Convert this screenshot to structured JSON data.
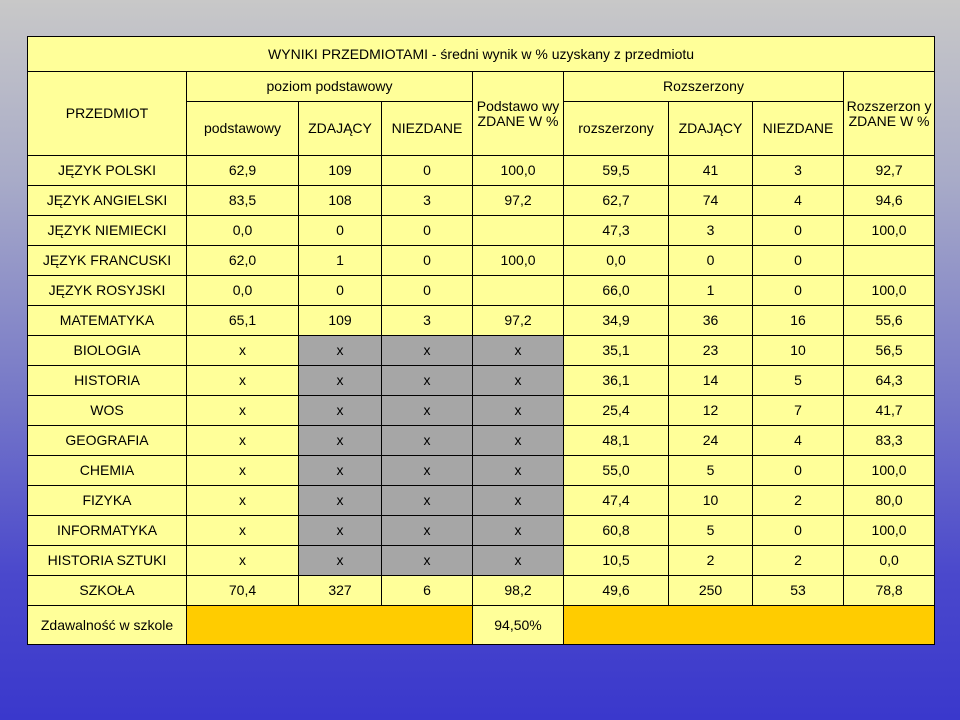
{
  "title": "WYNIKI PRZEDMIOTAMI - średni wynik w % uzyskany z przedmiotu",
  "headers": {
    "przedmiot": "PRZEDMIOT",
    "poziom_podstawowy": "poziom podstawowy",
    "podstawowy_zdane_pct": "Podstawo wy ZDANE W %",
    "rozszerzony_group": "Rozszerzony",
    "rozszerzony_zdane_pct": "Rozszerzon y ZDANE W %",
    "sub": [
      "podstawowy",
      "ZDAJĄCY",
      "NIEZDANE",
      "rozszerzony",
      "ZDAJĄCY",
      "NIEZDANE"
    ]
  },
  "rows": [
    {
      "subject": "JĘZYK POLSKI",
      "p_avg": "62,9",
      "p_taking": "109",
      "p_failed": "0",
      "p_pct": "100,0",
      "r_avg": "59,5",
      "r_taking": "41",
      "r_failed": "3",
      "r_pct": "92,7"
    },
    {
      "subject": "JĘZYK ANGIELSKI",
      "p_avg": "83,5",
      "p_taking": "108",
      "p_failed": "3",
      "p_pct": "97,2",
      "r_avg": "62,7",
      "r_taking": "74",
      "r_failed": "4",
      "r_pct": "94,6"
    },
    {
      "subject": "JĘZYK NIEMIECKI",
      "p_avg": "0,0",
      "p_taking": "0",
      "p_failed": "0",
      "p_pct": "",
      "r_avg": "47,3",
      "r_taking": "3",
      "r_failed": "0",
      "r_pct": "100,0"
    },
    {
      "subject": "JĘZYK FRANCUSKI",
      "p_avg": "62,0",
      "p_taking": "1",
      "p_failed": "0",
      "p_pct": "100,0",
      "r_avg": "0,0",
      "r_taking": "0",
      "r_failed": "0",
      "r_pct": ""
    },
    {
      "subject": "JĘZYK ROSYJSKI",
      "p_avg": "0,0",
      "p_taking": "0",
      "p_failed": "0",
      "p_pct": "",
      "r_avg": "66,0",
      "r_taking": "1",
      "r_failed": "0",
      "r_pct": "100,0"
    },
    {
      "subject": "MATEMATYKA",
      "p_avg": "65,1",
      "p_taking": "109",
      "p_failed": "3",
      "p_pct": "97,2",
      "r_avg": "34,9",
      "r_taking": "36",
      "r_failed": "16",
      "r_pct": "55,6"
    },
    {
      "subject": "BIOLOGIA",
      "p_avg": "x",
      "p_taking": "x",
      "p_failed": "x",
      "p_pct": "x",
      "r_avg": "35,1",
      "r_taking": "23",
      "r_failed": "10",
      "r_pct": "56,5"
    },
    {
      "subject": "HISTORIA",
      "p_avg": "x",
      "p_taking": "x",
      "p_failed": "x",
      "p_pct": "x",
      "r_avg": "36,1",
      "r_taking": "14",
      "r_failed": "5",
      "r_pct": "64,3"
    },
    {
      "subject": "WOS",
      "p_avg": "x",
      "p_taking": "x",
      "p_failed": "x",
      "p_pct": "x",
      "r_avg": "25,4",
      "r_taking": "12",
      "r_failed": "7",
      "r_pct": "41,7"
    },
    {
      "subject": "GEOGRAFIA",
      "p_avg": "x",
      "p_taking": "x",
      "p_failed": "x",
      "p_pct": "x",
      "r_avg": "48,1",
      "r_taking": "24",
      "r_failed": "4",
      "r_pct": "83,3"
    },
    {
      "subject": "CHEMIA",
      "p_avg": "x",
      "p_taking": "x",
      "p_failed": "x",
      "p_pct": "x",
      "r_avg": "55,0",
      "r_taking": "5",
      "r_failed": "0",
      "r_pct": "100,0"
    },
    {
      "subject": "FIZYKA",
      "p_avg": "x",
      "p_taking": "x",
      "p_failed": "x",
      "p_pct": "x",
      "r_avg": "47,4",
      "r_taking": "10",
      "r_failed": "2",
      "r_pct": "80,0"
    },
    {
      "subject": "INFORMATYKA",
      "p_avg": "x",
      "p_taking": "x",
      "p_failed": "x",
      "p_pct": "x",
      "r_avg": "60,8",
      "r_taking": "5",
      "r_failed": "0",
      "r_pct": "100,0"
    },
    {
      "subject": "HISTORIA SZTUKI",
      "p_avg": "x",
      "p_taking": "x",
      "p_failed": "x",
      "p_pct": "x",
      "r_avg": "10,5",
      "r_taking": "2",
      "r_failed": "2",
      "r_pct": "0,0"
    }
  ],
  "school_row": {
    "subject": "SZKOŁA",
    "p_avg": "70,4",
    "p_taking": "327",
    "p_failed": "6",
    "p_pct": "98,2",
    "r_avg": "49,6",
    "r_taking": "250",
    "r_failed": "53",
    "r_pct": "78,8"
  },
  "pass_rate": {
    "label": "Zdawalność w szkole",
    "value": "94,50%"
  },
  "colors": {
    "table_bg": "#ffff99",
    "gray_cell": "#a6a6a6",
    "gold_cell": "#ffcc00",
    "red_text": "#ff0000",
    "blue_text": "#1f3fb5"
  }
}
